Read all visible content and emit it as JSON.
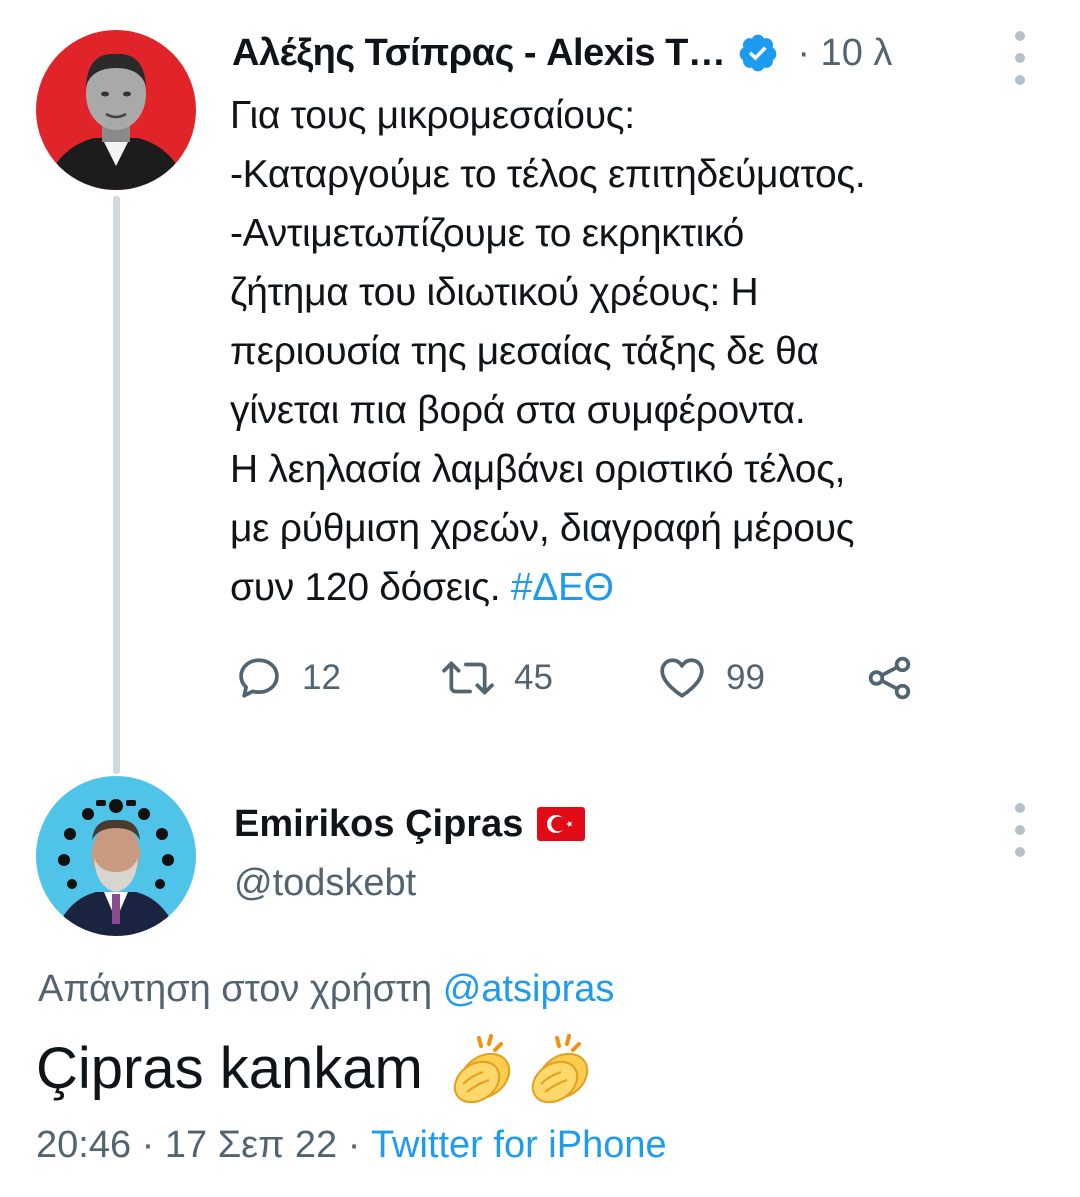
{
  "tweet": {
    "author_name": "Αλέξης Τσίπρας - Alexis T…",
    "time_ago": "· 10 λ",
    "text_lines": [
      "Για τους μικρομεσαίους:",
      "-Καταργούμε το τέλος επιτηδεύματος.",
      "-Αντιμετωπίζουμε το εκρηκτικό",
      "ζήτημα του ιδιωτικού χρέους: Η",
      "περιουσία της μεσαίας τάξης δε θα",
      "γίνεται πια βορά στα συμφέροντα.",
      "Η λεηλασία λαμβάνει οριστικό τέλος,",
      "με ρύθμιση χρεών, διαγραφή μέρους"
    ],
    "last_line_text": "συν 120 δόσεις. ",
    "hashtag": "#ΔΕΘ",
    "replies": "12",
    "retweets": "45",
    "likes": "99"
  },
  "reply": {
    "author_name": "Emirikos Çipras",
    "handle": "@todskebt",
    "reply_to_label": "Απάντηση στον χρήστη ",
    "reply_to_user": "@atsipras",
    "text": "Çipras kankam",
    "timestamp": "20:46 · 17 Σεπ 22 · ",
    "source": "Twitter for iPhone"
  },
  "icons": {
    "verified": "verified-badge-icon",
    "more": "more-vertical-icon",
    "reply": "reply-bubble-icon",
    "retweet": "retweet-icon",
    "like": "heart-icon",
    "share": "share-icon",
    "flag": "turkey-flag-icon",
    "emoji": "clapping-hands-emoji"
  },
  "colors": {
    "link": "#1d9bf0",
    "secondary_text": "#536471",
    "thread_line": "#cfd9de",
    "avatar1_bg": "#e0242a",
    "avatar2_bg": "#4fc3e8",
    "flag_red": "#e30a17"
  }
}
